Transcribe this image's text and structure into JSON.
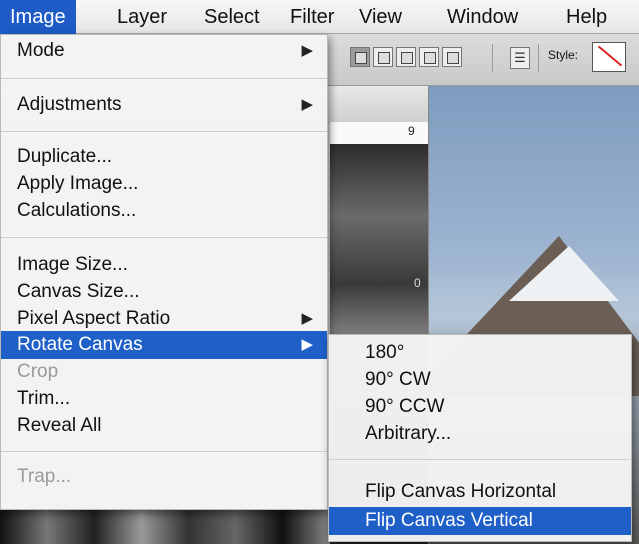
{
  "menubar": {
    "items": [
      {
        "label": "Image",
        "active": true
      },
      {
        "label": "Layer"
      },
      {
        "label": "Select"
      },
      {
        "label": "Filter"
      },
      {
        "label": "View"
      },
      {
        "label": "Window"
      },
      {
        "label": "Help"
      }
    ]
  },
  "options_bar": {
    "style_label": "Style:"
  },
  "rulers": {
    "n1": "9",
    "n2": "0"
  },
  "image_menu": {
    "items": [
      {
        "label": "Mode",
        "submenu": true
      },
      {
        "label": "Adjustments",
        "submenu": true
      },
      {
        "label": "Duplicate..."
      },
      {
        "label": "Apply Image..."
      },
      {
        "label": "Calculations..."
      },
      {
        "label": "Image Size..."
      },
      {
        "label": "Canvas Size..."
      },
      {
        "label": "Pixel Aspect Ratio",
        "submenu": true
      },
      {
        "label": "Rotate Canvas",
        "submenu": true,
        "highlighted": true
      },
      {
        "label": "Crop",
        "disabled": true
      },
      {
        "label": "Trim..."
      },
      {
        "label": "Reveal All"
      },
      {
        "label": "Trap...",
        "disabled": true
      }
    ]
  },
  "rotate_submenu": {
    "items": [
      {
        "label": "180°"
      },
      {
        "label": "90° CW"
      },
      {
        "label": "90° CCW"
      },
      {
        "label": "Arbitrary..."
      },
      {
        "label": "Flip Canvas Horizontal"
      },
      {
        "label": "Flip Canvas Vertical",
        "highlighted": true
      }
    ]
  },
  "colors": {
    "highlight": "#1f5fc8"
  }
}
